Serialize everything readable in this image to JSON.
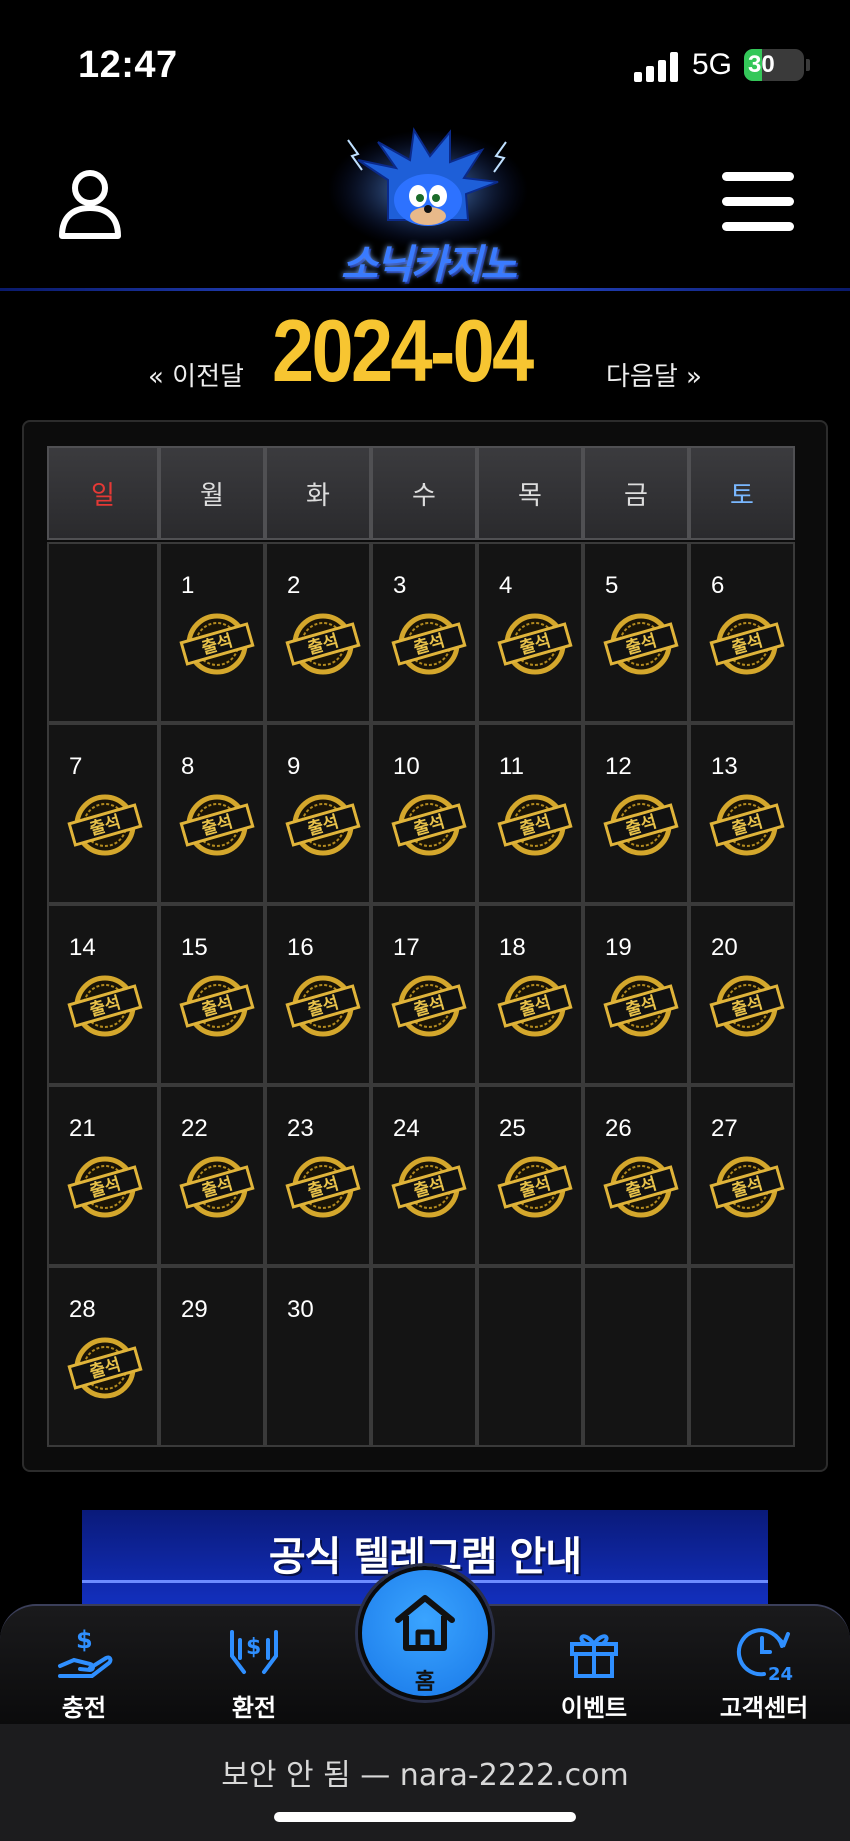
{
  "status_bar": {
    "time": "12:47",
    "network": "5G",
    "battery": "30",
    "battery_level": 0.3
  },
  "header": {
    "logo_text": "소닉카지노",
    "icons": [
      "user-icon",
      "menu-icon"
    ]
  },
  "month_nav": {
    "prev_label": "« 이전달",
    "title": "2024-04",
    "next_label": "다음달 »"
  },
  "calendar": {
    "weekdays": [
      "일",
      "월",
      "화",
      "수",
      "목",
      "금",
      "토"
    ],
    "days": [
      {
        "num": "",
        "stamp": false
      },
      {
        "num": "1",
        "stamp": true
      },
      {
        "num": "2",
        "stamp": true
      },
      {
        "num": "3",
        "stamp": true
      },
      {
        "num": "4",
        "stamp": true
      },
      {
        "num": "5",
        "stamp": true
      },
      {
        "num": "6",
        "stamp": true
      },
      {
        "num": "7",
        "stamp": true
      },
      {
        "num": "8",
        "stamp": true
      },
      {
        "num": "9",
        "stamp": true
      },
      {
        "num": "10",
        "stamp": true
      },
      {
        "num": "11",
        "stamp": true
      },
      {
        "num": "12",
        "stamp": true
      },
      {
        "num": "13",
        "stamp": true
      },
      {
        "num": "14",
        "stamp": true
      },
      {
        "num": "15",
        "stamp": true
      },
      {
        "num": "16",
        "stamp": true
      },
      {
        "num": "17",
        "stamp": true
      },
      {
        "num": "18",
        "stamp": true
      },
      {
        "num": "19",
        "stamp": true
      },
      {
        "num": "20",
        "stamp": true
      },
      {
        "num": "21",
        "stamp": true
      },
      {
        "num": "22",
        "stamp": true
      },
      {
        "num": "23",
        "stamp": true
      },
      {
        "num": "24",
        "stamp": true
      },
      {
        "num": "25",
        "stamp": true
      },
      {
        "num": "26",
        "stamp": true
      },
      {
        "num": "27",
        "stamp": true
      },
      {
        "num": "28",
        "stamp": true
      },
      {
        "num": "29",
        "stamp": false
      },
      {
        "num": "30",
        "stamp": false
      },
      {
        "num": "",
        "stamp": false
      },
      {
        "num": "",
        "stamp": false
      },
      {
        "num": "",
        "stamp": false
      },
      {
        "num": "",
        "stamp": false
      }
    ],
    "stamp_label": "출석",
    "colors": {
      "sunday": "#e53935",
      "saturday": "#7ab8ff",
      "stamp": "#d4a72c"
    }
  },
  "banner": {
    "title": "공식 텔레그램 안내"
  },
  "bottom_nav": {
    "items": [
      {
        "label": "충전",
        "icon": "charge-icon"
      },
      {
        "label": "환전",
        "icon": "exchange-icon"
      },
      {
        "label": "홈",
        "icon": "home-icon"
      },
      {
        "label": "이벤트",
        "icon": "gift-icon"
      },
      {
        "label": "고객센터",
        "icon": "support-24-icon"
      }
    ],
    "accent": "#2f8fff"
  },
  "address_bar": {
    "text": "보안 안 됨 — nara-2222.com"
  }
}
